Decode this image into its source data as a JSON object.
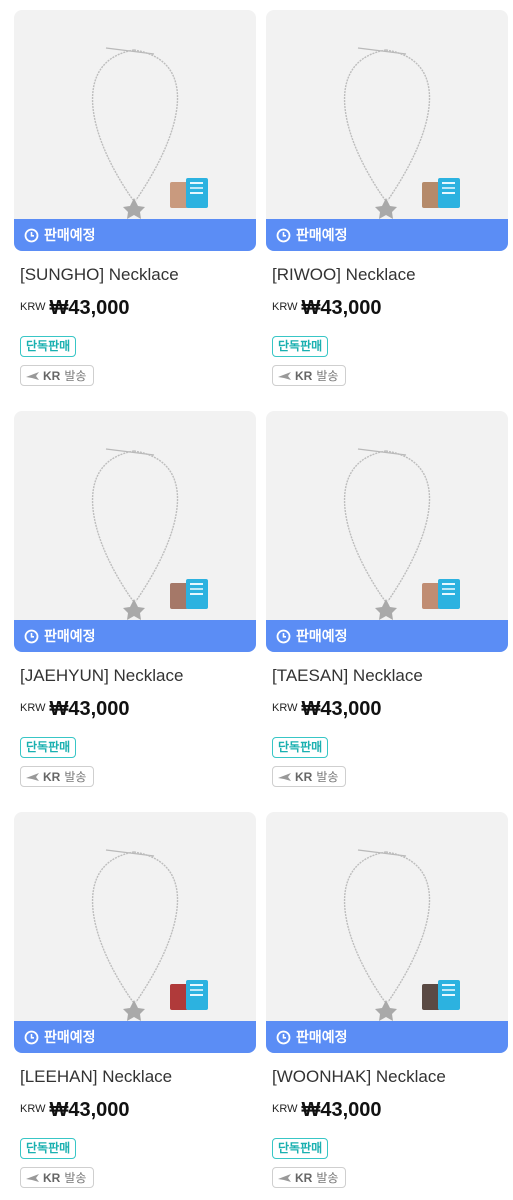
{
  "badge_label": "판매예정",
  "currency_label": "KRW",
  "exclusive_label": "단독판매",
  "ship_region": "KR",
  "ship_text": "발송",
  "products": [
    {
      "title": "[SUNGHO] Necklace",
      "price": "₩43,000",
      "photo_color": "#c99a7e"
    },
    {
      "title": "[RIWOO] Necklace",
      "price": "₩43,000",
      "photo_color": "#b58a6a"
    },
    {
      "title": "[JAEHYUN] Necklace",
      "price": "₩43,000",
      "photo_color": "#a57868"
    },
    {
      "title": "[TAESAN] Necklace",
      "price": "₩43,000",
      "photo_color": "#c08d73"
    },
    {
      "title": "[LEEHAN] Necklace",
      "price": "₩43,000",
      "photo_color": "#b03a3a"
    },
    {
      "title": "[WOONHAK] Necklace",
      "price": "₩43,000",
      "photo_color": "#5a4a44"
    }
  ]
}
